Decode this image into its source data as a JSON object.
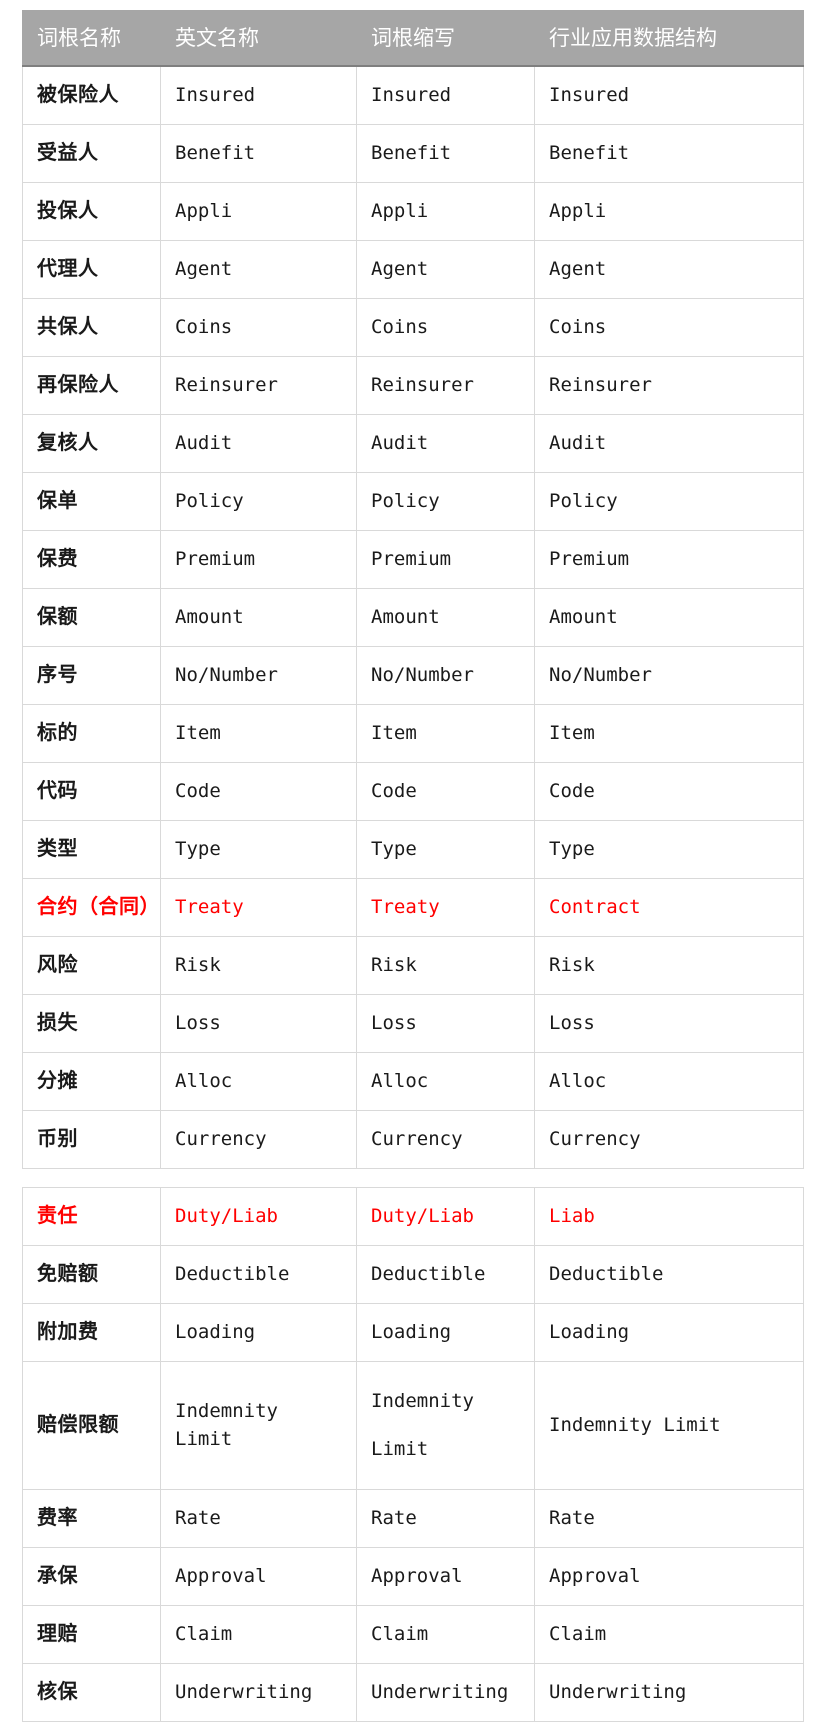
{
  "document": {
    "title": "保险行业词根对照表",
    "highlight_color": "#ff0000",
    "header_background": "#a6a6a6"
  },
  "tables": [
    {
      "name": "primary-glossary-table",
      "has_header": true,
      "columns": [
        "词根名称",
        "英文名称",
        "词根缩写",
        "行业应用数据结构"
      ],
      "rows": [
        {
          "term": "被保险人",
          "en": "Insured",
          "abbr": "Insured",
          "struct": "Insured",
          "highlight": false
        },
        {
          "term": "受益人",
          "en": "Benefit",
          "abbr": "Benefit",
          "struct": "Benefit",
          "highlight": false
        },
        {
          "term": "投保人",
          "en": "Appli",
          "abbr": "Appli",
          "struct": "Appli",
          "highlight": false
        },
        {
          "term": "代理人",
          "en": "Agent",
          "abbr": "Agent",
          "struct": "Agent",
          "highlight": false
        },
        {
          "term": "共保人",
          "en": "Coins",
          "abbr": "Coins",
          "struct": "Coins",
          "highlight": false
        },
        {
          "term": "再保险人",
          "en": "Reinsurer",
          "abbr": "Reinsurer",
          "struct": "Reinsurer",
          "highlight": false
        },
        {
          "term": "复核人",
          "en": "Audit",
          "abbr": "Audit",
          "struct": "Audit",
          "highlight": false
        },
        {
          "term": "保单",
          "en": "Policy",
          "abbr": "Policy",
          "struct": "Policy",
          "highlight": false
        },
        {
          "term": "保费",
          "en": "Premium",
          "abbr": "Premium",
          "struct": "Premium",
          "highlight": false
        },
        {
          "term": "保额",
          "en": "Amount",
          "abbr": "Amount",
          "struct": "Amount",
          "highlight": false
        },
        {
          "term": "序号",
          "en": "No/Number",
          "abbr": "No/Number",
          "struct": "No/Number",
          "highlight": false
        },
        {
          "term": "标的",
          "en": "Item",
          "abbr": "Item",
          "struct": "Item",
          "highlight": false
        },
        {
          "term": "代码",
          "en": "Code",
          "abbr": "Code",
          "struct": "Code",
          "highlight": false
        },
        {
          "term": "类型",
          "en": "Type",
          "abbr": "Type",
          "struct": "Type",
          "highlight": false
        },
        {
          "term": "合约（合同）",
          "en": "Treaty",
          "abbr": "Treaty",
          "struct": "Contract",
          "highlight": true
        },
        {
          "term": "风险",
          "en": "Risk",
          "abbr": "Risk",
          "struct": "Risk",
          "highlight": false
        },
        {
          "term": "损失",
          "en": "Loss",
          "abbr": "Loss",
          "struct": "Loss",
          "highlight": false
        },
        {
          "term": "分摊",
          "en": "Alloc",
          "abbr": "Alloc",
          "struct": "Alloc",
          "highlight": false
        },
        {
          "term": "币别",
          "en": "Currency",
          "abbr": "Currency",
          "struct": "Currency",
          "highlight": false
        }
      ]
    },
    {
      "name": "continuation-glossary-table",
      "has_header": false,
      "columns": [
        "词根名称",
        "英文名称",
        "词根缩写",
        "行业应用数据结构"
      ],
      "rows": [
        {
          "term": "责任",
          "en": "Duty/Liab",
          "abbr": "Duty/Liab",
          "struct": "Liab",
          "highlight": true
        },
        {
          "term": "免赔额",
          "en": "Deductible",
          "abbr": "Deductible",
          "struct": "Deductible",
          "highlight": false
        },
        {
          "term": "附加费",
          "en": "Loading",
          "abbr": "Loading",
          "struct": "Loading",
          "highlight": false
        },
        {
          "term": "赔偿限额",
          "en": "Indemnity Limit",
          "abbr": "Indemnity Limit",
          "struct": "Indemnity Limit",
          "highlight": false,
          "tall": true
        },
        {
          "term": "费率",
          "en": "Rate",
          "abbr": "Rate",
          "struct": "Rate",
          "highlight": false
        },
        {
          "term": "承保",
          "en": "Approval",
          "abbr": "Approval",
          "struct": "Approval",
          "highlight": false
        },
        {
          "term": "理赔",
          "en": "Claim",
          "abbr": "Claim",
          "struct": "Claim",
          "highlight": false
        },
        {
          "term": "核保",
          "en": "Underwriting",
          "abbr": "Underwriting",
          "struct": "Underwriting",
          "highlight": false
        }
      ]
    }
  ]
}
